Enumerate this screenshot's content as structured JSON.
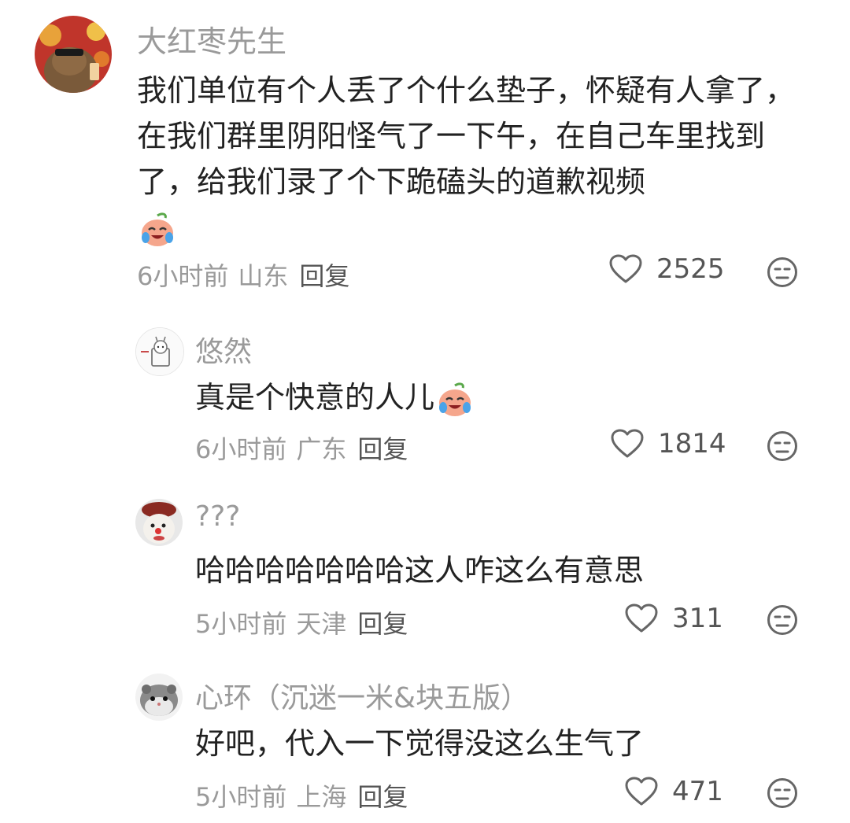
{
  "comments": [
    {
      "username": "大红枣先生",
      "text": "我们单位有个人丢了个什么垫子，怀疑有人拿了，在我们群里阴阳怪气了一下午，在自己车里找到了，给我们录了个下跪磕头的道歉视频",
      "emoji_icon": "crying-laughing-peach-icon",
      "time": "6小时前",
      "location": "山东",
      "reply_label": "回复",
      "likes": "2525"
    },
    {
      "username": "悠然",
      "text": "真是个快意的人儿",
      "emoji_icon": "crying-laughing-peach-icon",
      "time": "6小时前",
      "location": "广东",
      "reply_label": "回复",
      "likes": "1814"
    },
    {
      "username": "???",
      "text": "哈哈哈哈哈哈哈这人咋这么有意思",
      "time": "5小时前",
      "location": "天津",
      "reply_label": "回复",
      "likes": "311"
    },
    {
      "username": "心环（沉迷一米&块五版）",
      "text": "好吧，代入一下觉得没这么生气了",
      "time": "5小时前",
      "location": "上海",
      "reply_label": "回复",
      "likes": "471"
    }
  ],
  "icons": {
    "like": "heart-outline-icon",
    "dislike": "meh-face-icon"
  },
  "colors": {
    "text": "#222222",
    "muted": "#9a9a9a",
    "icon": "#666666"
  }
}
